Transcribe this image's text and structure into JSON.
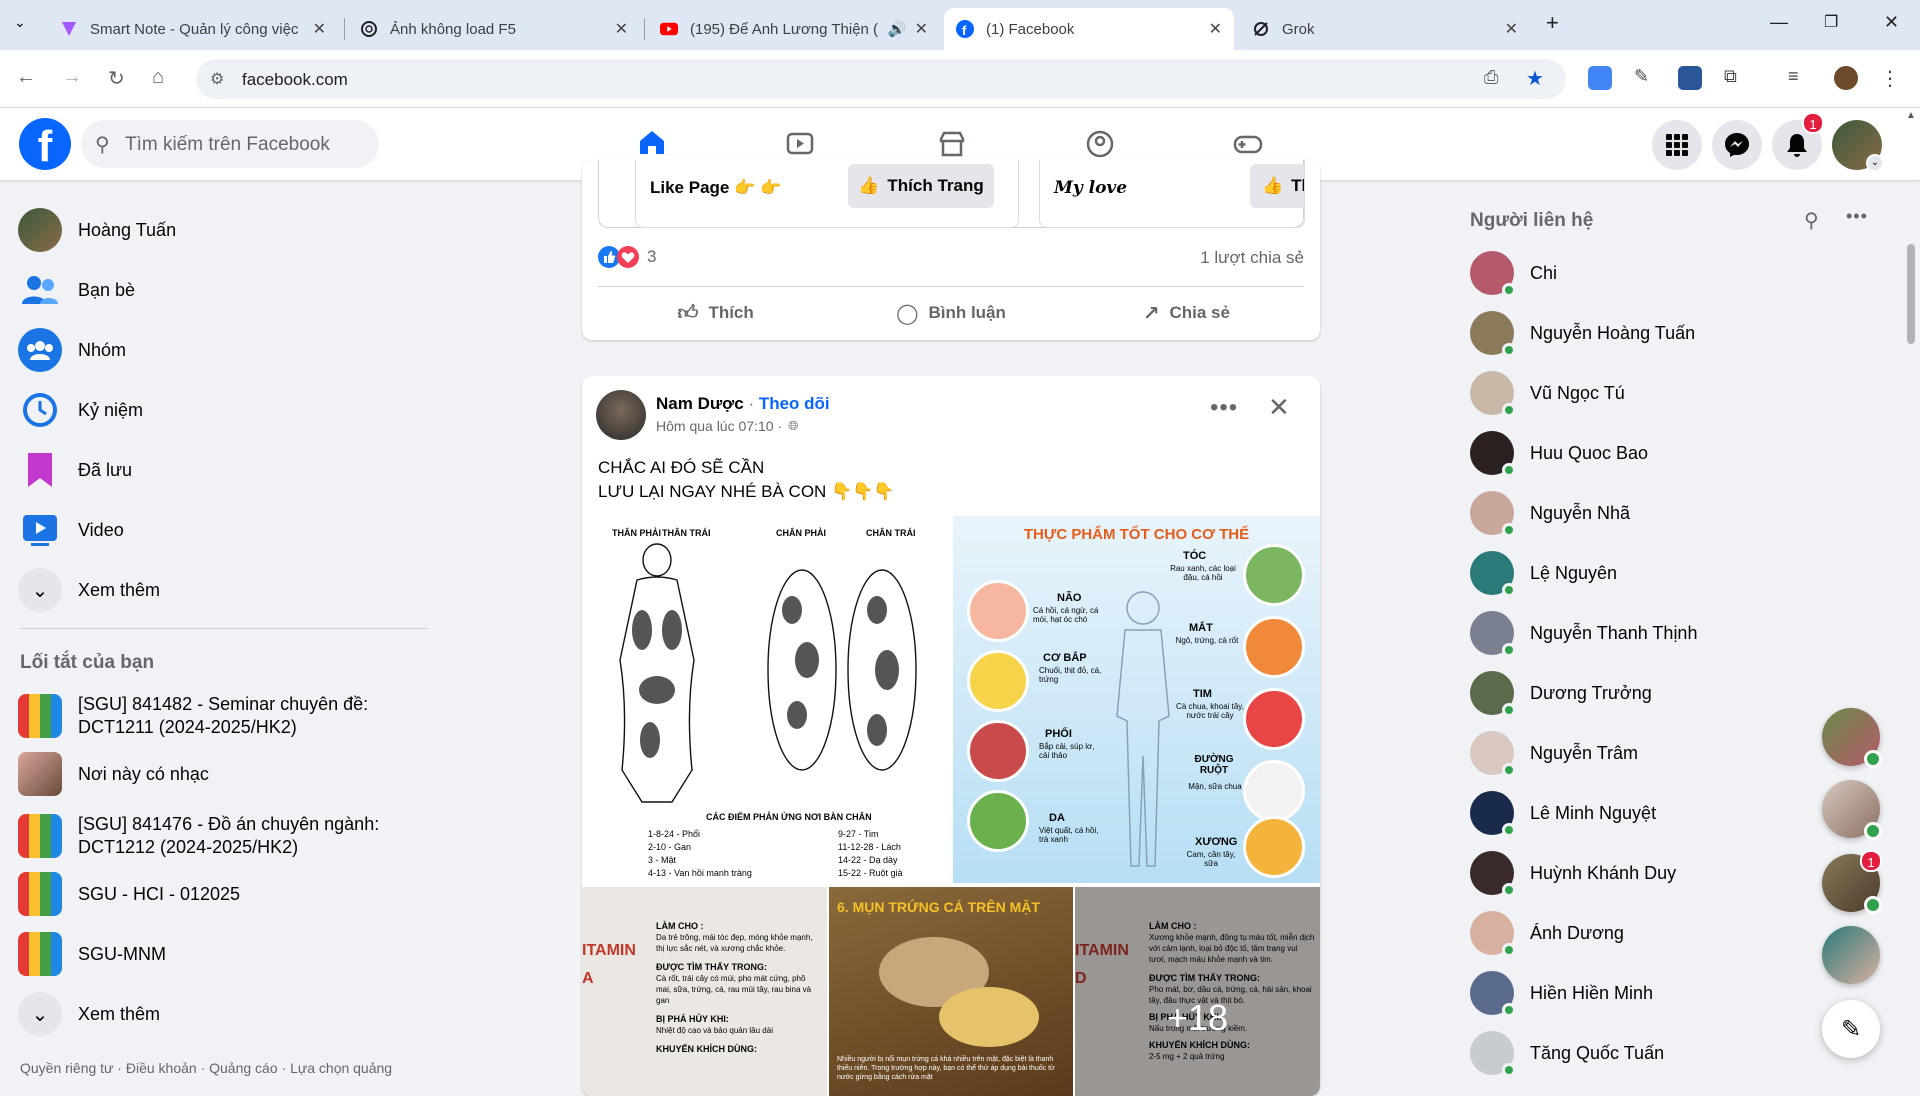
{
  "browser": {
    "tabs": [
      {
        "title": "Smart Note - Quản lý công việc",
        "icon": "smartnote-icon",
        "color": "#a259ff"
      },
      {
        "title": "Ảnh không load F5",
        "icon": "openai-icon",
        "color": "#202124"
      },
      {
        "title": "(195) Để Anh Lương Thiện (",
        "icon": "youtube-icon",
        "color": "#ff0000"
      },
      {
        "title": "(1) Facebook",
        "icon": "facebook-icon",
        "color": "#0866ff"
      },
      {
        "title": "Grok",
        "icon": "grok-icon",
        "color": "#202124"
      }
    ],
    "url": "facebook.com"
  },
  "fb": {
    "logo": "f",
    "search_placeholder": "Tìm kiếm trên Facebook",
    "notification_count": "1"
  },
  "sidebar": {
    "items": [
      {
        "label": "Hoàng Tuấn",
        "icon": "profile-avatar"
      },
      {
        "label": "Bạn bè",
        "icon": "friends-icon"
      },
      {
        "label": "Nhóm",
        "icon": "groups-icon"
      },
      {
        "label": "Kỷ niệm",
        "icon": "memories-icon"
      },
      {
        "label": "Đã lưu",
        "icon": "saved-icon"
      },
      {
        "label": "Video",
        "icon": "video-icon"
      },
      {
        "label": "Xem thêm",
        "icon": "chevron-down-icon"
      }
    ],
    "shortcuts_title": "Lối tắt của bạn",
    "shortcuts": [
      {
        "label": "[SGU] 841482 - Seminar chuyên đề: DCT1211 (2024-2025/HK2)"
      },
      {
        "label": "Nơi này có nhạc"
      },
      {
        "label": "[SGU] 841476 - Đồ án chuyên ngành: DCT1212 (2024-2025/HK2)"
      },
      {
        "label": "SGU - HCI - 012025"
      },
      {
        "label": "SGU-MNM"
      },
      {
        "label": "Xem thêm"
      }
    ],
    "footer": "Quyền riêng tư · Điều khoản · Quảng cáo · Lựa chọn quảng"
  },
  "post1": {
    "embed_left_text": "Like Page 👉 👉",
    "embed_left_button": "Thích Trang",
    "embed_right_text": "My love",
    "embed_right_button": "Thí",
    "reaction_count": "3",
    "shares": "1 lượt chia sẻ",
    "actions": {
      "like": "Thích",
      "comment": "Bình luận",
      "share": "Chia sẻ"
    }
  },
  "post2": {
    "author": "Nam Dược",
    "follow": "Theo dõi",
    "time": "Hôm qua lúc 07:10 ·",
    "text_line1": "CHẮC AI ĐÓ SẼ CẦN",
    "text_line2": "LƯU LẠI NGAY NHÉ BÀ CON 👇👇👇",
    "img1": {
      "headers": [
        "THÂN PHẢI",
        "THÂN TRÁI",
        "CHÂN PHẢI",
        "CHÂN TRÁI"
      ],
      "caption": "CÁC ĐIỂM PHẢN ỨNG NƠI BÀN CHÂN",
      "legend_left": [
        "1-8-24 - Phổi",
        "2-10 - Gan",
        "3 - Mật",
        "4-13 - Van hồi manh tràng"
      ],
      "legend_right": [
        "9-27 - Tim",
        "11-12-28 - Lách",
        "14-22 - Dạ dày",
        "15-22 - Ruột già"
      ]
    },
    "img2": {
      "title": "THỰC PHẨM TỐT CHO CƠ THỂ",
      "items": [
        {
          "name": "TÓC",
          "desc": "Rau xanh, các loại đậu, cá hồi"
        },
        {
          "name": "NÃO",
          "desc": "Cá hồi, cá ngừ, cá mòi, hạt óc chó"
        },
        {
          "name": "MẮT",
          "desc": "Ngô, trứng, cà rốt"
        },
        {
          "name": "CƠ BẮP",
          "desc": "Chuối, thịt đỏ, cá, trứng"
        },
        {
          "name": "TIM",
          "desc": "Cà chua, khoai tây, nước trái cây"
        },
        {
          "name": "PHỔI",
          "desc": "Bắp cải, súp lơ, cải thảo"
        },
        {
          "name": "ĐƯỜNG RUỘT",
          "desc": "Mận, sữa chua"
        },
        {
          "name": "DA",
          "desc": "Việt quất, cá hồi, trà xanh"
        },
        {
          "name": "XƯƠNG",
          "desc": "Cam, cần tây, sữa"
        }
      ]
    },
    "img3": {
      "vitamin": "ITAMIN A",
      "l1": "LÀM CHO :",
      "l1d": "Da trẻ trông, mái tóc đẹp, móng khỏe mạnh, thị lực sắc nét, và xương chắc khỏe.",
      "l2": "ĐƯỢC TÌM THẤY TRONG:",
      "l2d": "Cà rốt, trái cây có múi, pho mát cứng, phô mai, sữa, trứng, cá, rau mùi tây, rau bina và gan",
      "l3": "BỊ PHÁ HỦY KHI:",
      "l3d": "Nhiệt độ cao và bảo quản lâu dài",
      "l4": "KHUYẾN KHÍCH DÙNG:"
    },
    "img4": {
      "title": "6. MỤN TRỨNG CÁ TRÊN MẶT",
      "desc": "Nhiều người bị nổi mụn trứng cá khá nhiều trên mặt, đặc biệt là thanh thiếu niên. Trong trường hợp này, bạn có thể thử áp dụng bài thuốc từ nước gừng bằng cách rửa mặt"
    },
    "img5": {
      "vitamin": "ITAMIN D",
      "l1": "LÀM CHO :",
      "l1d": "Xương khỏe mạnh, đông tụ máu tốt, miễn dịch với cảm lạnh, loại bỏ độc tố, tầm trạng vui tươi, mạch máu khỏe mạnh và tim.",
      "l2": "ĐƯỢC TÌM THẤY TRONG:",
      "l2d": "Pho mát, bơ, dầu cá, trứng, cá, hải sản, khoai tây, đậu thực vật và thịt bò.",
      "l3": "BỊ PHÁ HỦY KHI:",
      "l3d": "Nấu trong môi trường kiềm.",
      "l4": "KHUYẾN KHÍCH DÙNG:",
      "l4d": "2-5 mg + 2 quả trứng"
    },
    "more_count": "+18"
  },
  "contacts": {
    "title": "Người liên hệ",
    "list": [
      {
        "name": "Chi",
        "color": "#b55a6a"
      },
      {
        "name": "Nguyễn Hoàng Tuấn",
        "color": "#8a7a5a"
      },
      {
        "name": "Vũ Ngọc Tú",
        "color": "#c9b8a8"
      },
      {
        "name": "Huu Quoc Bao",
        "color": "#2a2020"
      },
      {
        "name": "Nguyễn Nhã",
        "color": "#c8a89a"
      },
      {
        "name": "Lệ Nguyên",
        "color": "#2a7a7a"
      },
      {
        "name": "Nguyễn Thanh Thịnh",
        "color": "#7a8090"
      },
      {
        "name": "Dương Trưởng",
        "color": "#5a6a4a"
      },
      {
        "name": "Nguyễn Trâm",
        "color": "#d8c8c0"
      },
      {
        "name": "Lê Minh Nguyệt",
        "color": "#1a2a4a"
      },
      {
        "name": "Huỳnh Khánh Duy",
        "color": "#3a2a2a"
      },
      {
        "name": "Ánh Dương",
        "color": "#d8b0a0"
      },
      {
        "name": "Hiền Hiền Minh",
        "color": "#5a6a8a"
      },
      {
        "name": "Tăng Quốc Tuấn",
        "color": "#c8ccd0"
      }
    ]
  },
  "chat_bubbles": {
    "badge": "1"
  }
}
